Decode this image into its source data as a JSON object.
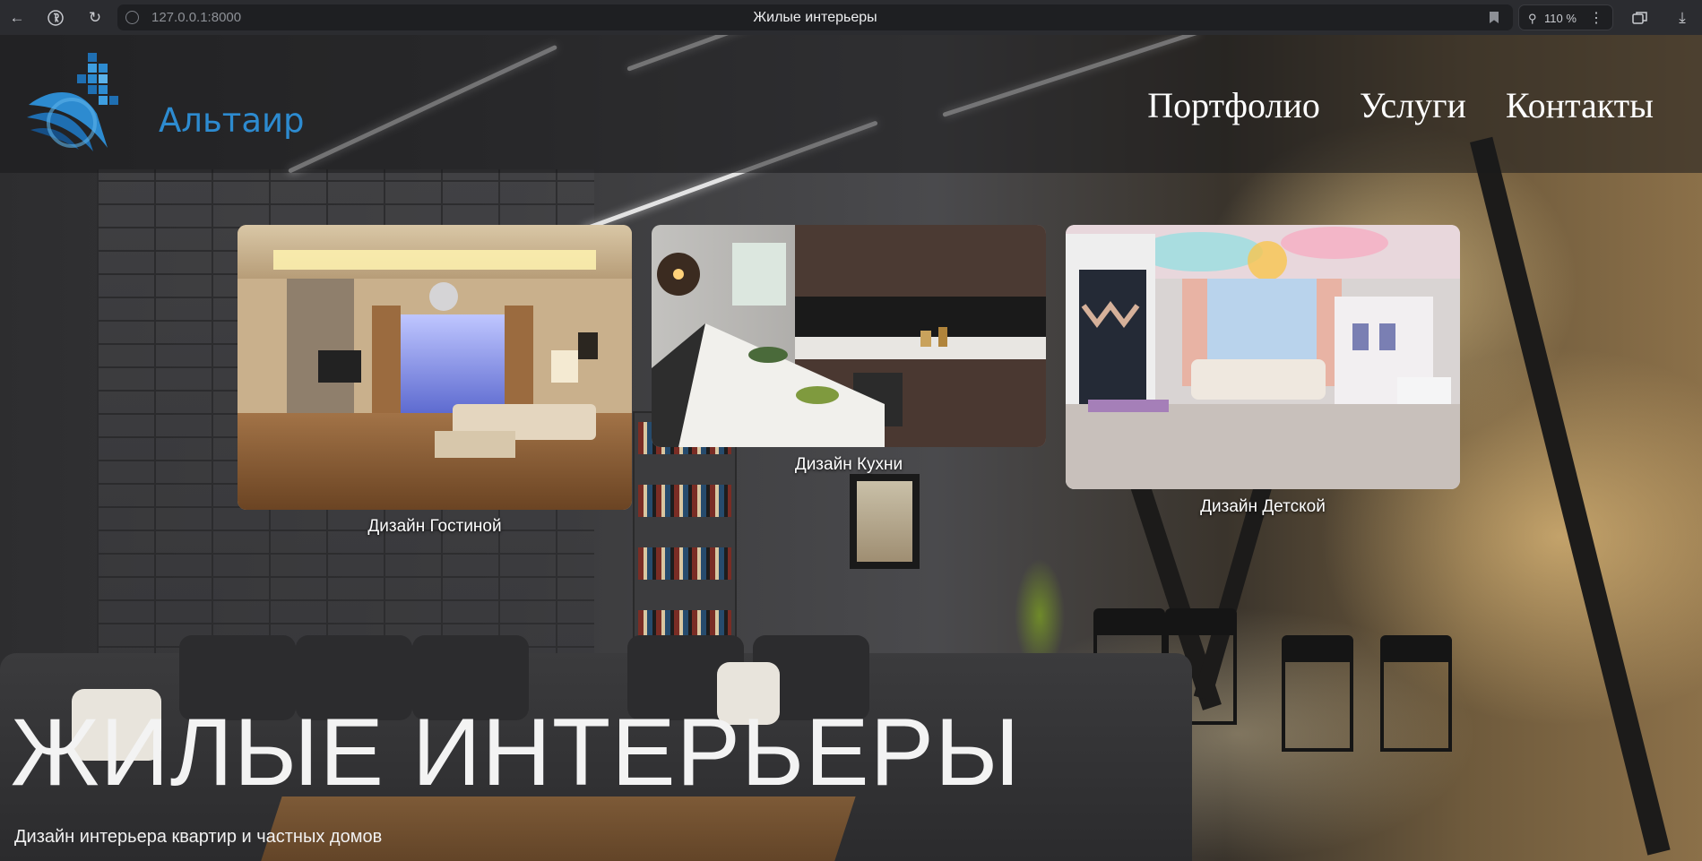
{
  "browser": {
    "url": "127.0.0.1:8000",
    "tab_title": "Жилые интерьеры",
    "zoom": "110 %"
  },
  "header": {
    "logo_text": "Альтаир",
    "nav": [
      "Портфолио",
      "Услуги",
      "Контакты"
    ]
  },
  "cards": [
    {
      "caption": "Дизайн Гостиной"
    },
    {
      "caption": "Дизайн Кухни"
    },
    {
      "caption": "Дизайн Детской"
    }
  ],
  "hero": {
    "title": "ЖИЛЫЕ ИНТЕРЬЕРЫ",
    "subtitle": "Дизайн интерьера квартир и частных домов"
  },
  "colors": {
    "brand_blue": "#2d8bd0",
    "chrome_bg": "#2b2c30",
    "header_overlay": "rgba(25,25,27,0.55)"
  }
}
